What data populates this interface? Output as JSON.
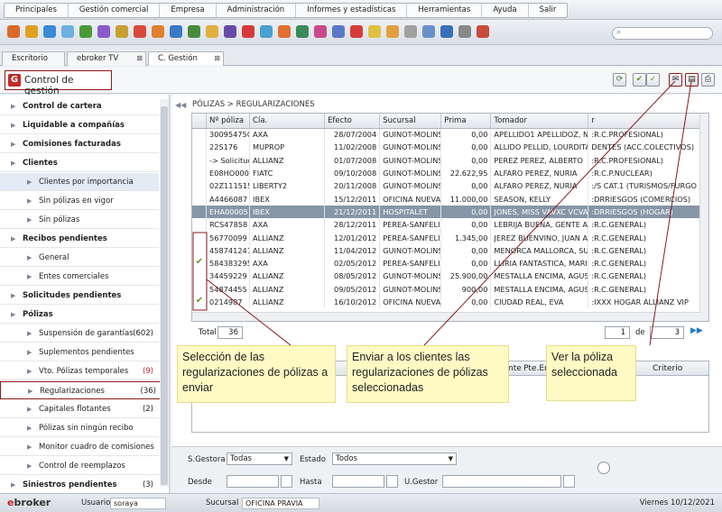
{
  "menu": [
    "Principales",
    "Gestión comercial",
    "Empresa",
    "Administración",
    "Informes y estadísticas",
    "Herramientas",
    "Ayuda",
    "Salir"
  ],
  "tabs": [
    "Escritorio",
    "ebroker TV",
    "C. Gestión"
  ],
  "page_title": "Control de gestión",
  "breadcrumb": "PÓLIZAS > REGULARIZACIONES",
  "sidebar": [
    {
      "label": "Control de cartera",
      "count": ""
    },
    {
      "label": "Liquidable a compañías",
      "count": ""
    },
    {
      "label": "Comisiones facturadas",
      "count": ""
    },
    {
      "label": "Clientes",
      "count": ""
    },
    {
      "label": "Clientes por importancia",
      "count": ""
    },
    {
      "label": "Sin pólizas en vigor",
      "count": ""
    },
    {
      "label": "Sin pólizas",
      "count": ""
    },
    {
      "label": "Recibos pendientes",
      "count": ""
    },
    {
      "label": "General",
      "count": ""
    },
    {
      "label": "Entes comerciales",
      "count": ""
    },
    {
      "label": "Solicitudes pendientes",
      "count": ""
    },
    {
      "label": "Pólizas",
      "count": ""
    },
    {
      "label": "Suspensión de garantías",
      "count": "(602)"
    },
    {
      "label": "Suplementos pendientes",
      "count": ""
    },
    {
      "label": "Vto. Pólizas temporales",
      "count": "(9)"
    },
    {
      "label": "Regularizaciones",
      "count": "(36)"
    },
    {
      "label": "Capitales flotantes",
      "count": "(2)"
    },
    {
      "label": "Pólizas sin ningún recibo",
      "count": ""
    },
    {
      "label": "Monitor cuadro de comisiones",
      "count": ""
    },
    {
      "label": "Control de reemplazos",
      "count": ""
    },
    {
      "label": "Siniestros pendientes",
      "count": "(3)"
    }
  ],
  "grid": {
    "columns": [
      "Nº póliza",
      "Cía.",
      "Efecto",
      "Sucursal",
      "Prima",
      "Tomador",
      "r"
    ],
    "rows": [
      [
        "30095475C",
        "AXA",
        "28/07/2004",
        "GUINOT-MOLINS",
        "0,00",
        "APELLIDO1 APELLIDOZ, NO",
        ":R.C.PROFESIONAL)"
      ],
      [
        "22S176",
        "MUPROP",
        "11/02/2008",
        "GUINOT-MOLINS",
        "0,00",
        "ALLIDO PELLID, LOURDITAS",
        "DENTES (ACC.COLECTIVOS)"
      ],
      [
        "-> Solicitud",
        "ALLIANZ",
        "01/07/2008",
        "GUINOT-MOLINS",
        "0,00",
        "PEREZ PEREZ, ALBERTO",
        ":R.C.PROFESIONAL)"
      ],
      [
        "E08HO000",
        "FIATC",
        "09/10/2008",
        "GUINOT-MOLINS",
        "22.622,95",
        "ALFARO PEREZ, NURIA",
        ":R.C.P.NUCLEAR)"
      ],
      [
        "02Z111515",
        "LIBERTY2",
        "20/11/2008",
        "GUINOT-MOLINS",
        "0,00",
        "ALFARO PEREZ, NURIA",
        ":/S CAT.1 (TURISMOS/FURGO"
      ],
      [
        "A4466087",
        "IBEX",
        "15/12/2011",
        "OFICINA NUEVA",
        "11.000,00",
        "SEASON, KELLY",
        ":DRRIESGOS (COMERCIOS)"
      ],
      [
        "EHA00005",
        "IBEX",
        "21/12/2011",
        "HOSPITALET",
        "0,00",
        "JONES, MISS VAVXC VCVA",
        ":DRRIESGOS (HOGAR)"
      ],
      [
        "RCS47858",
        "AXA",
        "28/12/2011",
        "PEREA-SANFELIU",
        "0,00",
        "LEBRIJA BUENA, GENTE ANT",
        ":R.C.GENERAL)"
      ],
      [
        "56770099",
        "ALLIANZ",
        "12/01/2012",
        "PEREA-SANFELIU",
        "1.345,00",
        "JEREZ BUENVINO, JUAN ANC",
        ":R.C.GENERAL)"
      ],
      [
        "458741241",
        "ALLIANZ",
        "11/04/2012",
        "GUINOT-MOLINS",
        "0,00",
        "MENORCA MALLORCA, SUS",
        ":R.C.GENERAL)"
      ],
      [
        "584383295",
        "AXA",
        "02/05/2012",
        "PEREA-SANFELIU",
        "0,00",
        "LLIRIA FANTASTICA, MARIA",
        ":R.C.GENERAL)"
      ],
      [
        "34459229",
        "ALLIANZ",
        "08/05/2012",
        "GUINOT-MOLINS",
        "25.900,00",
        "MESTALLA ENCIMA, AGUST",
        ":R.C.GENERAL)"
      ],
      [
        "54874455",
        "ALLIANZ",
        "09/05/2012",
        "GUINOT-MOLINS",
        "900,00",
        "MESTALLA ENCIMA, AGUST",
        ":R.C.GENERAL)"
      ],
      [
        "0214987",
        "ALLIANZ",
        "16/10/2012",
        "OFICINA NUEVA",
        "0,00",
        "CIUDAD REAL, EVA",
        ":IXXX HOGAR ALLIANZ VIP"
      ]
    ],
    "selected_row": 6,
    "checked_rows": [
      10,
      13
    ]
  },
  "pager": {
    "total_label": "Total",
    "total": "36",
    "page": "1",
    "of_label": "de",
    "pages": "3"
  },
  "lower_grid": {
    "columns": [
      "nte",
      "Pte.Em",
      "Criterio"
    ]
  },
  "callouts": [
    "Selección de las regularizaciones de pólizas a enviar",
    "Enviar a los clientes las regularizaciones de pólizas seleccionadas",
    "Ver la póliza seleccionada"
  ],
  "filters": {
    "gestora_label": "S.Gestora",
    "gestora_value": "Todas",
    "estado_label": "Estado",
    "estado_value": "Todos",
    "desde_label": "Desde",
    "hasta_label": "Hasta",
    "ugestor_label": "U.Gestor"
  },
  "status": {
    "logo": "ebroker",
    "usuario_label": "Usuario",
    "usuario": "soraya",
    "sucursal_label": "Sucursal",
    "sucursal": "OFICINA PRAVIA",
    "date": "Viernes 10/12/2021"
  },
  "colors": {
    "accent_red": "#c62828",
    "selected_row": "#8796a6",
    "callout": "#fff9c4",
    "connector": "#8b1a1a"
  }
}
